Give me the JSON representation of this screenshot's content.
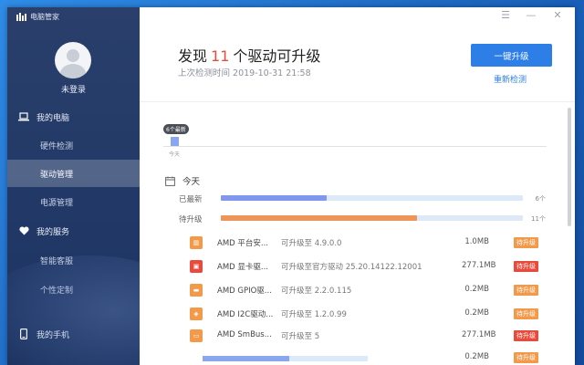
{
  "app": {
    "title": "电脑管家"
  },
  "window_controls": {
    "menu": "☰",
    "minimize": "—",
    "close": "✕"
  },
  "sidebar": {
    "user_label": "未登录",
    "items": [
      {
        "label": "我的电脑"
      },
      {
        "label": "硬件检测"
      },
      {
        "label": "驱动管理"
      },
      {
        "label": "电源管理"
      },
      {
        "label": "我的服务"
      },
      {
        "label": "智能客服"
      },
      {
        "label": "个性定制"
      },
      {
        "label": "我的手机"
      }
    ]
  },
  "header": {
    "title_prefix": "发现",
    "count": "11",
    "title_suffix": "个驱动可升级",
    "last_check": "上次检测时间 2019-10-31 21:58",
    "primary_button": "一键升级",
    "recheck_link": "重新检测"
  },
  "timeline": {
    "badge": "6个最新",
    "day": "今天",
    "marker_fraction": 1.0
  },
  "today": {
    "label": "今天",
    "rows": [
      {
        "label": "已最新",
        "count": "6个",
        "fill_percent": 35,
        "color": "#7f97ec"
      },
      {
        "label": "待升级",
        "count": "11个",
        "fill_percent": 65,
        "color": "#ee955a"
      }
    ]
  },
  "drivers": [
    {
      "name": "AMD 平台安...",
      "version": "可升级至 4.9.0.0",
      "size": "1.0MB",
      "tag": "待升级",
      "tag_color": "#f2994a",
      "icon_color": "#f2994a",
      "icon": "▥"
    },
    {
      "name": "AMD 显卡驱...",
      "version": "可升级至官方驱动 25.20.14122.12001",
      "size": "277.1MB",
      "tag": "待升级",
      "tag_color": "#e84b3c",
      "icon_color": "#e84b3c",
      "icon": "▣"
    },
    {
      "name": "AMD GPIO驱...",
      "version": "可升级至 2.2.0.115",
      "size": "0.2MB",
      "tag": "待升级",
      "tag_color": "#f2994a",
      "icon_color": "#f2994a",
      "icon": "▬"
    },
    {
      "name": "AMD I2C驱动...",
      "version": "可升级至 1.2.0.99",
      "size": "0.2MB",
      "tag": "待升级",
      "tag_color": "#f2994a",
      "icon_color": "#f2994a",
      "icon": "◈"
    },
    {
      "name": "AMD SmBus...",
      "version": "可升级至 5",
      "size": "277.1MB",
      "tag": "待升级",
      "tag_color": "#e84b3c",
      "icon_color": "#f2994a",
      "icon": "▭"
    },
    {
      "name": "",
      "version": "",
      "size": "0.2MB",
      "tag": "待升级",
      "tag_color": "#f2994a",
      "icon_color": "",
      "icon": ""
    }
  ],
  "colors": {
    "accent": "#2d7ee6",
    "sidebar": "#233a68",
    "highlight": "#e84b3c"
  }
}
